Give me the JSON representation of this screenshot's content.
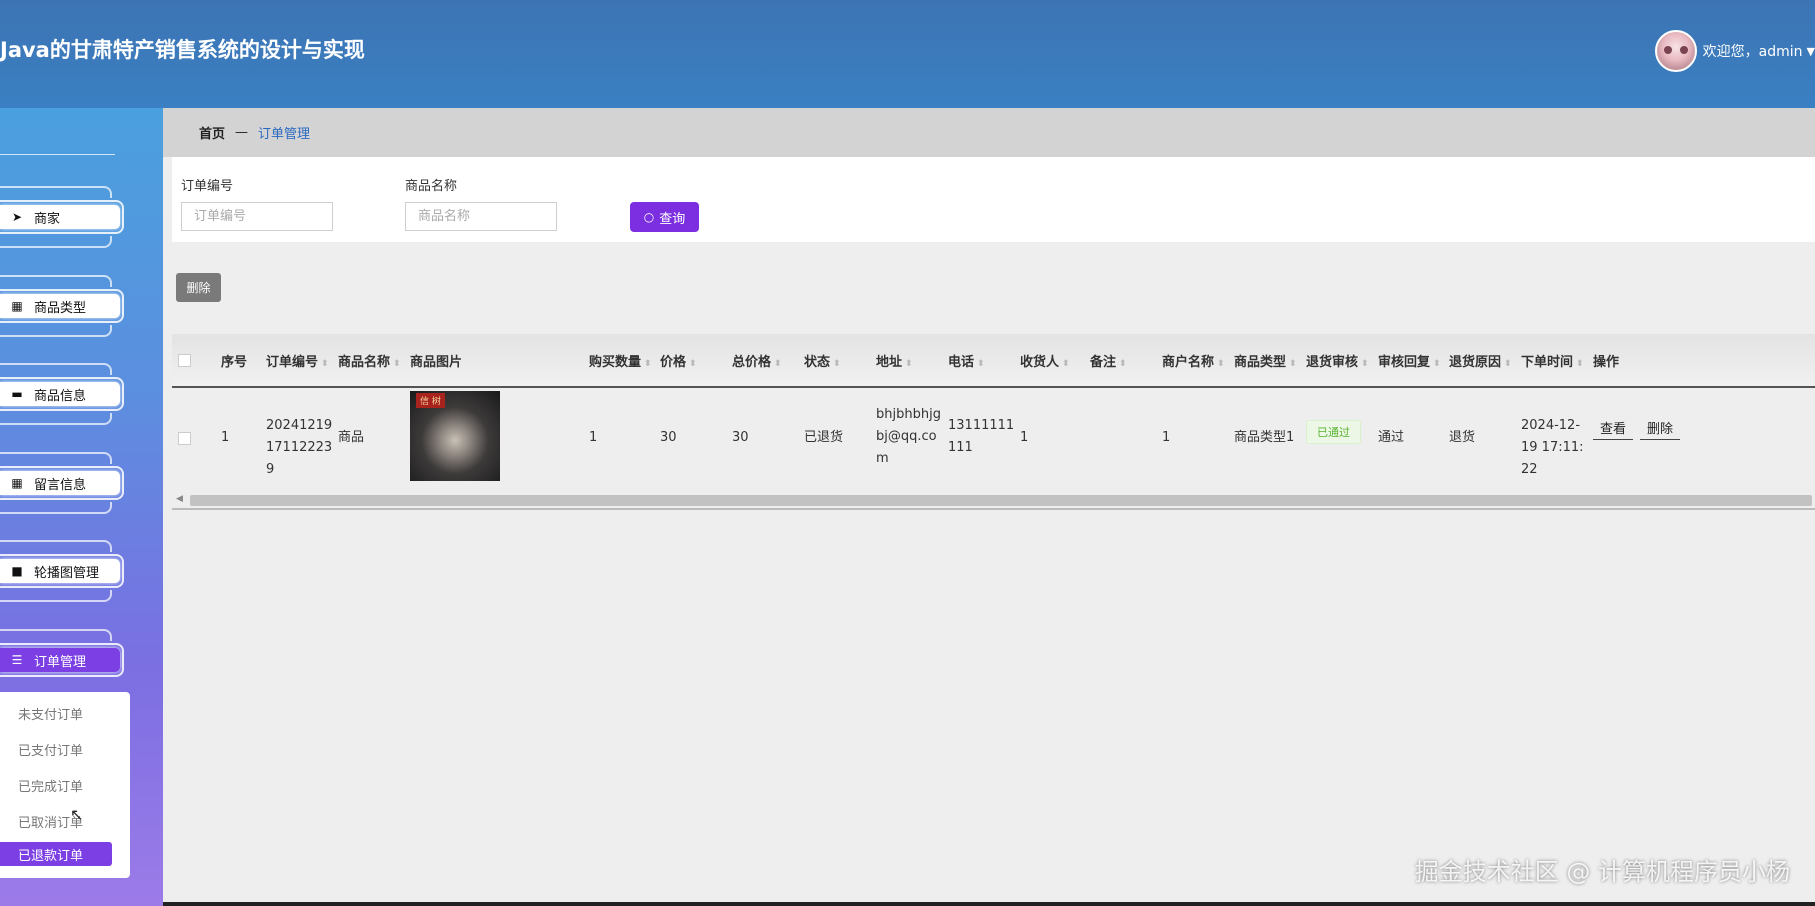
{
  "header": {
    "app_title": "Java的甘肃特产销售系统的设计与实现",
    "welcome": "欢迎您，admin",
    "avatar_icon": "user-avatar",
    "caret_icon": "caret-down-icon"
  },
  "sidebar": {
    "items": [
      {
        "label": "商家",
        "icon": "send-icon"
      },
      {
        "label": "商品类型",
        "icon": "grid-icon"
      },
      {
        "label": "商品信息",
        "icon": "briefcase-icon"
      },
      {
        "label": "留言信息",
        "icon": "grid-icon"
      },
      {
        "label": "轮播图管理",
        "icon": "slideshow-icon"
      },
      {
        "label": "订单管理",
        "icon": "list-icon"
      }
    ],
    "active_item": "订单管理",
    "submenu": [
      "未支付订单",
      "已支付订单",
      "已完成订单",
      "已取消订单",
      "已退款订单"
    ],
    "active_submenu": "已退款订单"
  },
  "breadcrumb": {
    "home": "首页",
    "separator": "—",
    "current": "订单管理"
  },
  "search": {
    "order_no_label": "订单编号",
    "order_no_placeholder": "订单编号",
    "product_name_label": "商品名称",
    "product_name_placeholder": "商品名称",
    "query_button": "查询"
  },
  "toolbar": {
    "delete_button": "删除"
  },
  "table": {
    "columns": [
      "序号",
      "订单编号",
      "商品名称",
      "商品图片",
      "购买数量",
      "价格",
      "总价格",
      "状态",
      "地址",
      "电话",
      "收货人",
      "备注",
      "商户名称",
      "商品类型",
      "退货审核",
      "审核回复",
      "退货原因",
      "下单时间",
      "操作"
    ],
    "rows": [
      {
        "index": "1",
        "order_no": "20241219171122239",
        "product_name": "商品",
        "image_tag": "信 树",
        "quantity": "1",
        "price": "30",
        "total": "30",
        "status": "已退货",
        "address": "bhjbhbhjgbj@qq.com",
        "phone": "13111111111",
        "receiver": "1",
        "remark": "",
        "merchant": "1",
        "product_type": "商品类型1",
        "return_review": "已通过",
        "review_reply": "通过",
        "return_reason": "退货",
        "order_time": "2024-12-19 17:11:22",
        "actions": [
          "查看",
          "删除"
        ]
      }
    ]
  },
  "watermark": "掘金技术社区 @ 计算机程序员小杨",
  "colors": {
    "header": "#3a7bbf",
    "accent": "#7b2fe0",
    "success": "#59b232"
  }
}
